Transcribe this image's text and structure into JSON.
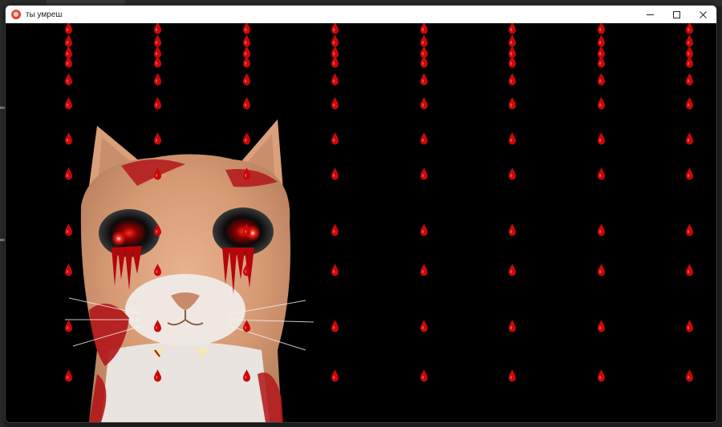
{
  "window": {
    "title": "ты умреш"
  },
  "icons": {
    "app": "app-icon",
    "minimize": "minimize-icon",
    "maximize": "maximize-icon",
    "close": "close-icon"
  },
  "colors": {
    "titlebar": "#ffffff",
    "content_background": "#000000",
    "blood": "#c8080a"
  },
  "scene": {
    "cat_image": "cat-with-bleeding-eyes",
    "drop_icon": "blood-drop-icon"
  }
}
